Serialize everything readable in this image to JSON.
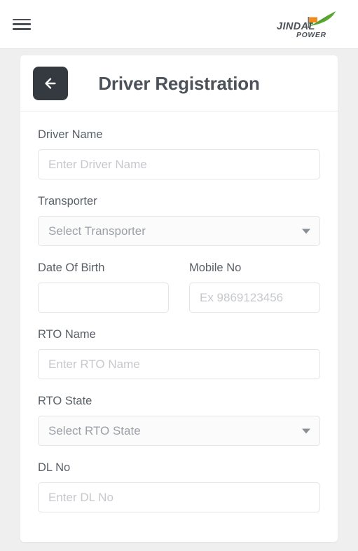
{
  "navbar": {
    "menu_icon": "hamburger-menu-icon",
    "logo": {
      "primary_text": "JINDAL",
      "secondary_text": "POWER",
      "text_color": "#4d5259",
      "flag_orange": "#f18a20",
      "flag_green": "#4a9b3c",
      "swoosh_green": "#5aa832"
    }
  },
  "card": {
    "back_button_icon": "arrow-left-icon",
    "back_button_color": "#343a40",
    "title": "Driver Registration"
  },
  "form": {
    "fields": [
      {
        "name": "driver-name",
        "label": "Driver Name",
        "type": "text",
        "value": "",
        "placeholder": "Enter Driver Name"
      },
      {
        "name": "transporter",
        "label": "Transporter",
        "type": "select",
        "value": "Select Transporter",
        "placeholder": "Select Transporter"
      },
      {
        "name": "date-of-birth",
        "label": "Date Of Birth",
        "type": "text",
        "value": "",
        "placeholder": ""
      },
      {
        "name": "mobile-no",
        "label": "Mobile No",
        "type": "text",
        "value": "",
        "placeholder": "Ex 9869123456"
      },
      {
        "name": "rto-name",
        "label": "RTO Name",
        "type": "text",
        "value": "",
        "placeholder": "Enter RTO Name"
      },
      {
        "name": "rto-state",
        "label": "RTO State",
        "type": "select",
        "value": "Select RTO State",
        "placeholder": "Select RTO State"
      },
      {
        "name": "dl-no",
        "label": "DL No",
        "type": "text",
        "value": "",
        "placeholder": "Enter DL No"
      }
    ]
  }
}
